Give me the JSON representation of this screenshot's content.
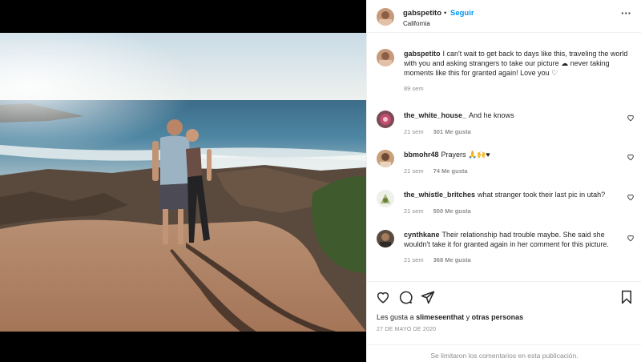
{
  "post": {
    "username": "gabspetito",
    "separator": "•",
    "follow_label": "Seguir",
    "location": "California",
    "more_label": "···"
  },
  "caption": {
    "username": "gabspetito",
    "text": "I can't wait to get back to days like this, traveling the world with you and asking strangers to take our picture ☁ never taking moments like this for granted again! Love you ♡",
    "time": "89 sem"
  },
  "comments": [
    {
      "username": "the_white_house_",
      "text": "And he knows",
      "time": "21 sem",
      "likes": "301 Me gusta"
    },
    {
      "username": "bbmohr48",
      "text": "Prayers 🙏🙌♥",
      "time": "21 sem",
      "likes": "74 Me gusta"
    },
    {
      "username": "the_whistle_britches",
      "text": "what stranger took their last pic in utah?",
      "time": "21 sem",
      "likes": "500 Me gusta"
    },
    {
      "username": "cynthkane",
      "text": "Their relationship had trouble maybe. She said she wouldn't take it for granted again in her comment for this picture.",
      "time": "21 sem",
      "likes": "368 Me gusta"
    }
  ],
  "footer": {
    "likes_prefix": "Les gusta a",
    "likes_user": "slimeseenthat",
    "likes_joiner": "y",
    "likes_others": "otras personas",
    "date": "27 DE MAYO DE 2020",
    "comments_limited": "Se limitaron los comentarios en esta publicación."
  },
  "icons": {
    "heart": "heart-icon",
    "comment": "comment-icon",
    "share": "share-icon",
    "save": "bookmark-icon",
    "more": "more-options-icon"
  },
  "colors": {
    "follow_blue": "#0095f6",
    "muted_gray": "#8e8e8e",
    "text_dark": "#262626"
  }
}
